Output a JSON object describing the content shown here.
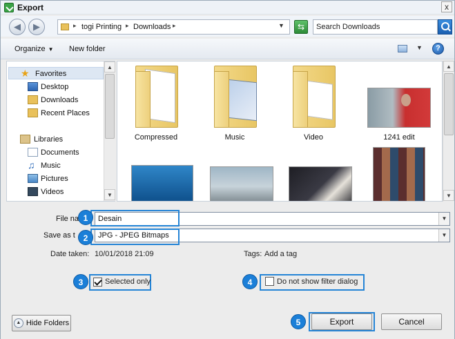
{
  "window": {
    "title": "Export",
    "close_label": "x"
  },
  "address": {
    "breadcrumbs": [
      "togi Printing",
      "Downloads"
    ],
    "search_placeholder": "Search Downloads"
  },
  "toolbar": {
    "organize": "Organize",
    "new_folder": "New folder",
    "help": "?"
  },
  "nav": {
    "favorites": "Favorites",
    "desktop": "Desktop",
    "downloads": "Downloads",
    "recent": "Recent Places",
    "libraries": "Libraries",
    "documents": "Documents",
    "music": "Music",
    "pictures": "Pictures",
    "videos": "Videos"
  },
  "files": [
    {
      "name": "Compressed",
      "kind": "folder"
    },
    {
      "name": "Music",
      "kind": "folder"
    },
    {
      "name": "Video",
      "kind": "folder"
    },
    {
      "name": "1241 edit",
      "kind": "image"
    }
  ],
  "form": {
    "file_name_label": "File na",
    "file_name_value": "Desain",
    "save_as_label": "Save as t",
    "save_as_value": "JPG - JPEG Bitmaps",
    "date_taken_label": "Date taken:",
    "date_taken_value": "10/01/2018 21:09",
    "tags_label": "Tags:",
    "tags_value": "Add a tag",
    "selected_only": "Selected only",
    "selected_only_checked": true,
    "no_filter_dialog": "Do not show filter dialog",
    "no_filter_dialog_checked": false
  },
  "buttons": {
    "hide_folders": "Hide Folders",
    "export": "Export",
    "cancel": "Cancel"
  },
  "badges": [
    "1",
    "2",
    "3",
    "4",
    "5"
  ],
  "colors": {
    "highlight": "#2484d6",
    "badge": "#1b7fd8",
    "folder": "#e9c15b"
  }
}
